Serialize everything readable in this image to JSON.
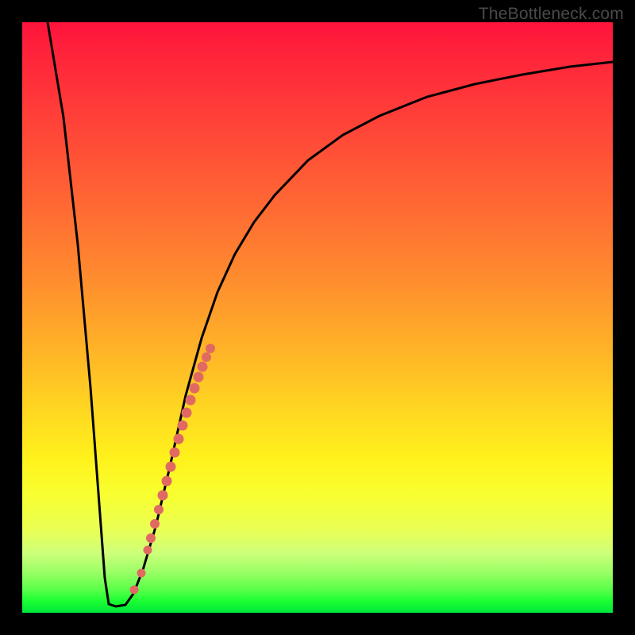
{
  "watermark": "TheBottleneck.com",
  "chart_data": {
    "type": "line",
    "title": "",
    "xlabel": "",
    "ylabel": "",
    "xlim": [
      0,
      100
    ],
    "ylim": [
      0,
      100
    ],
    "series": [
      {
        "name": "bottleneck-curve",
        "x": [
          0,
          2,
          4,
          6,
          8,
          9,
          10,
          11,
          12,
          13,
          14,
          16,
          18,
          20,
          22,
          24,
          26,
          28,
          30,
          34,
          38,
          42,
          48,
          55,
          62,
          70,
          80,
          90,
          100
        ],
        "y": [
          100,
          79,
          58,
          37,
          16,
          6,
          1,
          1,
          1,
          2,
          4,
          9,
          17,
          27,
          36,
          44,
          51,
          57,
          62,
          70,
          76,
          80,
          84,
          88,
          90,
          92,
          94,
          95,
          96
        ]
      }
    ],
    "highlight_points": {
      "name": "marker-dots",
      "x": [
        16,
        17,
        18,
        19,
        20,
        20.5,
        21,
        21.5,
        22,
        22.5,
        23,
        23.5,
        24,
        24.5,
        25,
        25.5,
        26,
        26.5,
        27
      ],
      "y": [
        8,
        12,
        17,
        22,
        27,
        30,
        33,
        35.5,
        38,
        40,
        42,
        44,
        46,
        47.5,
        49,
        50.5,
        52,
        53.5,
        55
      ]
    },
    "colors": {
      "curve": "#000000",
      "dots": "#e06a62",
      "gradient_top": "#ff143c",
      "gradient_bottom": "#00e63a"
    }
  }
}
